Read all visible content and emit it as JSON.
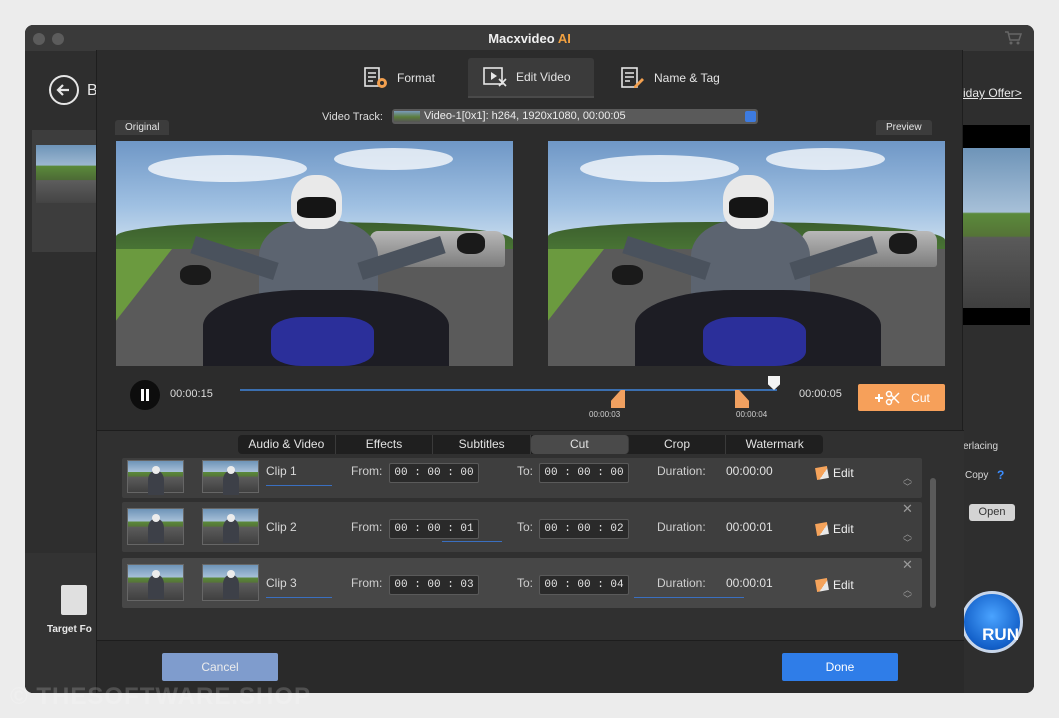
{
  "app": {
    "title_main": "Macxvideo",
    "title_accent": "AI"
  },
  "background": {
    "back_letter": "B",
    "offer_link": "iday Offer>",
    "target_label": "Target Fo",
    "interlacing_label": "erlacing",
    "copy_label": "Copy",
    "copy_help": "?",
    "open_button": "Open",
    "run_button": "RUN"
  },
  "dialog": {
    "tabs": [
      {
        "label": "Format",
        "icon": "format-gear-icon"
      },
      {
        "label": "Edit Video",
        "icon": "edit-video-icon"
      },
      {
        "label": "Name & Tag",
        "icon": "name-tag-icon"
      }
    ],
    "active_tab": "Edit Video",
    "video_track": {
      "label": "Video Track:",
      "value": "Video-1[0x1]: h264, 1920x1080, 00:00:05"
    },
    "original_label": "Original",
    "preview_label": "Preview",
    "playback": {
      "current_time": "00:00:15",
      "end_time": "00:00:05",
      "marker_start": "00:00:03",
      "marker_end": "00:00:04",
      "cut_label": "Cut"
    },
    "subtabs": [
      "Audio & Video",
      "Effects",
      "Subtitles",
      "Cut",
      "Crop",
      "Watermark"
    ],
    "active_subtab": "Cut",
    "clips": [
      {
        "label": "Clip 1",
        "from_label": "From:",
        "from": "00 : 00 : 00",
        "to_label": "To:",
        "to": "00 : 00 : 00",
        "duration_label": "Duration:",
        "duration": "00:00:00",
        "edit": "Edit"
      },
      {
        "label": "Clip 2",
        "from_label": "From:",
        "from": "00 : 00 : 01",
        "to_label": "To:",
        "to": "00 : 00 : 02",
        "duration_label": "Duration:",
        "duration": "00:00:01",
        "edit": "Edit"
      },
      {
        "label": "Clip 3",
        "from_label": "From:",
        "from": "00 : 00 : 03",
        "to_label": "To:",
        "to": "00 : 00 : 04",
        "duration_label": "Duration:",
        "duration": "00:00:01",
        "edit": "Edit"
      }
    ],
    "cancel_label": "Cancel",
    "done_label": "Done"
  },
  "watermark": "© THESOFTWARE.SHOP",
  "colors": {
    "accent_orange": "#f6a05a",
    "done_blue": "#2f7de8",
    "cancel_blue": "#7f9ccd"
  }
}
